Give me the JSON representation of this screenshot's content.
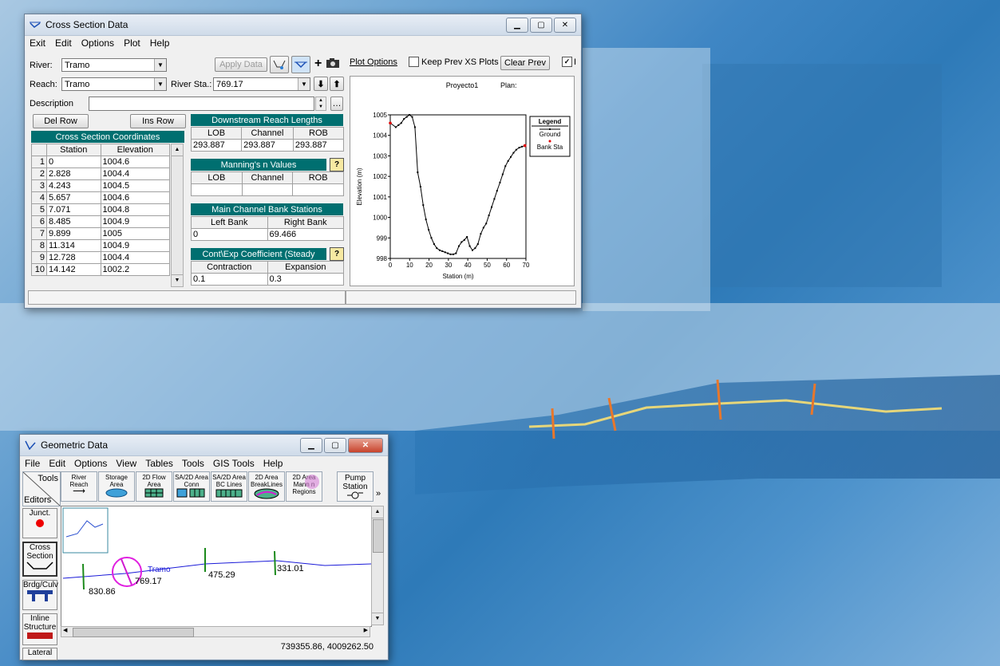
{
  "cross_section_window": {
    "title": "Cross Section Data",
    "menu": [
      "Exit",
      "Edit",
      "Options",
      "Plot",
      "Help"
    ],
    "river_label": "River:",
    "river_value": "Tramo",
    "reach_label": "Reach:",
    "reach_value": "Tramo",
    "river_sta_label": "River Sta.:",
    "river_sta_value": "769.17",
    "apply_data": "Apply Data",
    "description_label": "Description",
    "description_value": "",
    "del_row": "Del Row",
    "ins_row": "Ins Row",
    "coords_header": "Cross Section Coordinates",
    "coords_columns": [
      "Station",
      "Elevation"
    ],
    "coords_rows": [
      [
        "1",
        "0",
        "1004.6"
      ],
      [
        "2",
        "2.828",
        "1004.4"
      ],
      [
        "3",
        "4.243",
        "1004.5"
      ],
      [
        "4",
        "5.657",
        "1004.6"
      ],
      [
        "5",
        "7.071",
        "1004.8"
      ],
      [
        "6",
        "8.485",
        "1004.9"
      ],
      [
        "7",
        "9.899",
        "1005"
      ],
      [
        "8",
        "11.314",
        "1004.9"
      ],
      [
        "9",
        "12.728",
        "1004.4"
      ],
      [
        "10",
        "14.142",
        "1002.2"
      ]
    ],
    "downstream_header": "Downstream Reach Lengths",
    "downstream_columns": [
      "LOB",
      "Channel",
      "ROB"
    ],
    "downstream_values": [
      "293.887",
      "293.887",
      "293.887"
    ],
    "mannings_header": "Manning's n Values",
    "mannings_columns": [
      "LOB",
      "Channel",
      "ROB"
    ],
    "mannings_values": [
      "",
      "",
      ""
    ],
    "bank_header": "Main Channel Bank Stations",
    "bank_columns": [
      "Left Bank",
      "Right Bank"
    ],
    "bank_values": [
      "0",
      "69.466"
    ],
    "coef_header": "Cont\\Exp Coefficient (Steady",
    "coef_columns": [
      "Contraction",
      "Expansion"
    ],
    "coef_values": [
      "0.1",
      "0.3"
    ],
    "help_glyph": "?",
    "plot_options": "Plot Options",
    "keep_prev": "Keep Prev XS Plots",
    "clear_prev": "Clear Prev",
    "checkbox_mark": "✓",
    "checkbox_label": "I"
  },
  "chart_data": {
    "type": "line",
    "title": "Proyecto1",
    "plan_label": "Plan:",
    "xlabel": "Station (m)",
    "ylabel": "Elevation (m)",
    "xlim": [
      0,
      70
    ],
    "ylim": [
      998,
      1005
    ],
    "xticks": [
      "0",
      "10",
      "20",
      "30",
      "40",
      "50",
      "60",
      "70"
    ],
    "yticks": [
      "998",
      "999",
      "1000",
      "1001",
      "1002",
      "1003",
      "1004",
      "1005"
    ],
    "legend_title": "Legend",
    "legend_entries": [
      "Ground",
      "Bank Sta"
    ],
    "series": [
      {
        "name": "Ground",
        "x": [
          0,
          2.828,
          4.243,
          5.657,
          7.071,
          8.485,
          9.899,
          11.314,
          12.728,
          14.142,
          15.6,
          17,
          18.4,
          19.8,
          21.2,
          22.6,
          24,
          25.5,
          26.9,
          28.3,
          29.7,
          31.1,
          32.5,
          33.9,
          35.4,
          36.8,
          38.2,
          39.6,
          41,
          42.4,
          43.8,
          45.2,
          46.7,
          48.1,
          49.5,
          50.9,
          52.3,
          53.7,
          55.1,
          56.6,
          58,
          59.4,
          60.8,
          62.2,
          63.6,
          65,
          66.5,
          67.9,
          69.466
        ],
        "y": [
          1004.6,
          1004.4,
          1004.5,
          1004.6,
          1004.8,
          1004.9,
          1005,
          1004.9,
          1004.4,
          1002.2,
          1001.5,
          1000.6,
          999.9,
          999.4,
          999,
          998.7,
          998.5,
          998.4,
          998.35,
          998.3,
          998.25,
          998.2,
          998.2,
          998.25,
          998.6,
          998.8,
          998.9,
          999.05,
          998.6,
          998.4,
          998.5,
          998.7,
          999.2,
          999.5,
          999.7,
          1000.1,
          1000.5,
          1000.9,
          1001.3,
          1001.7,
          1002.1,
          1002.5,
          1002.75,
          1002.95,
          1003.15,
          1003.3,
          1003.4,
          1003.45,
          1003.5
        ]
      },
      {
        "name": "Bank Sta",
        "x": [
          0,
          69.466
        ],
        "y": [
          1004.6,
          1003.5
        ]
      }
    ],
    "colors": {
      "ground": "#000000",
      "bank": "#e00000"
    }
  },
  "geometric_window": {
    "title": "Geometric Data",
    "menu": [
      "File",
      "Edit",
      "Options",
      "View",
      "Tables",
      "Tools",
      "GIS Tools",
      "Help"
    ],
    "tools_label": "Tools",
    "editors_label": "Editors",
    "toolbar": [
      {
        "line1": "River",
        "line2": "Reach"
      },
      {
        "line1": "Storage",
        "line2": "Area"
      },
      {
        "line1": "2D Flow",
        "line2": "Area"
      },
      {
        "line1": "SA/2D Area",
        "line2": "Conn"
      },
      {
        "line1": "SA/2D Area",
        "line2": "BC Lines"
      },
      {
        "line1": "2D Area",
        "line2": "BreakLines"
      },
      {
        "line1": "2D Area",
        "line2": "Mann n",
        "line3": "Regions"
      },
      {
        "line1": "Pump",
        "line2": "Station"
      }
    ],
    "editors": [
      {
        "label": "Junct."
      },
      {
        "label": "Cross Section"
      },
      {
        "label": "Brdg/Culv"
      },
      {
        "label": "Inline Structure"
      },
      {
        "label": "Lateral"
      }
    ],
    "station_labels": [
      "830.86",
      "769.17",
      "475.29",
      "331.01"
    ],
    "river_label": "Tramo",
    "coordinates": "739355.86, 4009262.50"
  }
}
